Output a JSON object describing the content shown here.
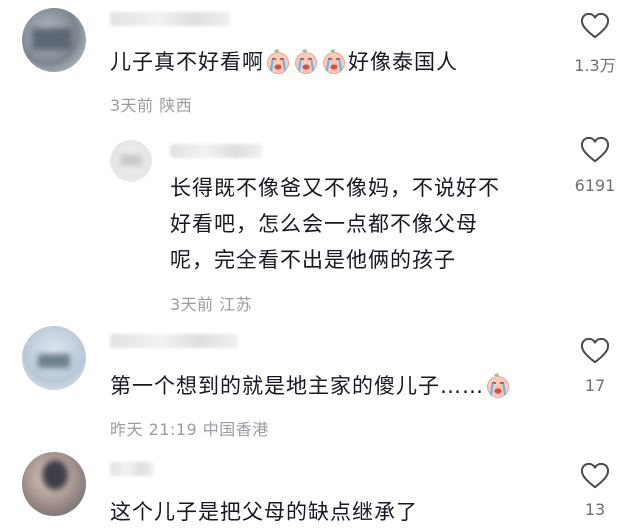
{
  "comments": [
    {
      "text_before": "儿子真不好看啊",
      "text_after": "好像泰国人",
      "emoji": "crying-face-emoji",
      "emoji_count": 3,
      "meta": "3天前 陕西",
      "likes": "1.3万"
    },
    {
      "text_line1": "长得既不像爸又不像妈，不说好不",
      "text_line2": "好看吧，怎么会一点都不像父母",
      "text_line3": "呢，完全看不出是他俩的孩子",
      "meta": "3天前 江苏",
      "likes": "6191"
    },
    {
      "text": "第一个想到的就是地主家的傻儿子……",
      "emoji": "crying-face-emoji",
      "meta": "昨天 21:19 中国香港",
      "likes": "17"
    },
    {
      "text": "这个儿子是把父母的缺点继承了",
      "likes": "13"
    }
  ],
  "colors": {
    "text": "#161823",
    "meta": "#9b9ca1",
    "count": "#6e6f74",
    "heart": "#4a4b50"
  },
  "icons": {
    "like": "heart-outline-icon"
  }
}
